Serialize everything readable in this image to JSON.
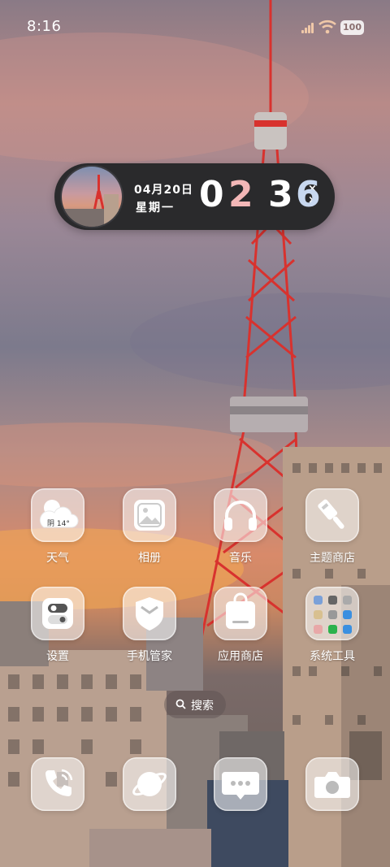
{
  "status_bar": {
    "time": "8:16",
    "battery": "100"
  },
  "widget": {
    "date": "04月20日",
    "weekday": "星期一",
    "digits": [
      "0",
      "2",
      "3",
      "6"
    ],
    "digit_colors": [
      "#ffffff",
      "#f3b7b7",
      "#ffffff",
      "#c8d8f0"
    ],
    "separator": "×"
  },
  "apps": [
    {
      "label": "天气",
      "icon": "weather-icon",
      "badge": "阴 14°"
    },
    {
      "label": "相册",
      "icon": "gallery-icon"
    },
    {
      "label": "音乐",
      "icon": "headphones-icon"
    },
    {
      "label": "主题商店",
      "icon": "paintbrush-icon"
    },
    {
      "label": "设置",
      "icon": "toggle-settings-icon"
    },
    {
      "label": "手机管家",
      "icon": "shield-icon"
    },
    {
      "label": "应用商店",
      "icon": "shopping-bag-icon"
    },
    {
      "label": "系统工具",
      "icon": "folder-icon"
    }
  ],
  "search": {
    "label": "搜索"
  },
  "dock": [
    {
      "icon": "phone-icon"
    },
    {
      "icon": "browser-planet-icon"
    },
    {
      "icon": "message-icon"
    },
    {
      "icon": "camera-icon"
    }
  ]
}
